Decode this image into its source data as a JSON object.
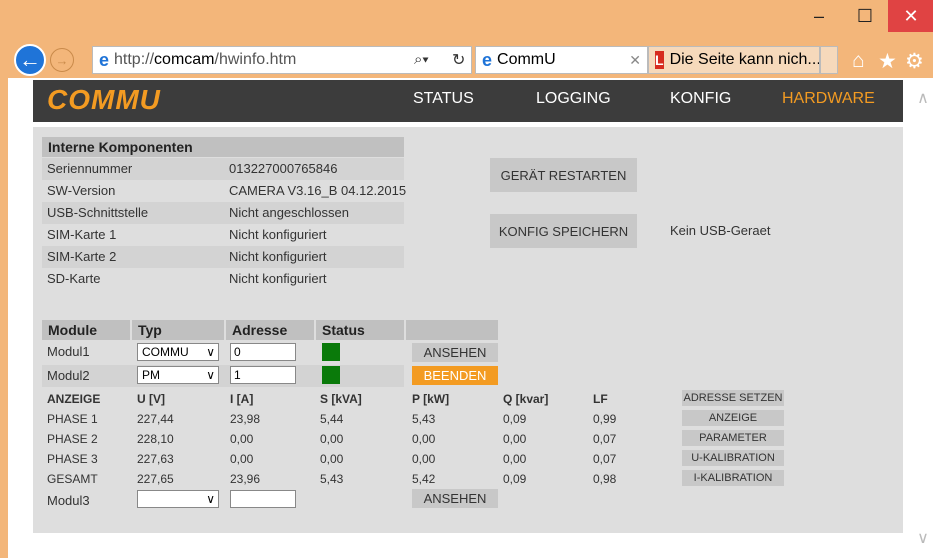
{
  "browser": {
    "url_prefix": "http://",
    "url_host": "comcam",
    "url_path": "/hwinfo.htm",
    "tab1_title": "CommU",
    "tab2_title": "Die Seite kann nich...",
    "tab2_badge": "L"
  },
  "nav": {
    "logo": "COMMU",
    "items": [
      "STATUS",
      "LOGGING",
      "KONFIG",
      "HARDWARE"
    ],
    "active": "HARDWARE",
    "accent": "#f39b22"
  },
  "interne": {
    "header": "Interne Komponenten",
    "rows": [
      {
        "label": "Seriennummer",
        "value": "013227000765846"
      },
      {
        "label": "SW-Version",
        "value": "CAMERA V3.16_B 04.12.2015"
      },
      {
        "label": "USB-Schnittstelle",
        "value": "Nicht angeschlossen"
      },
      {
        "label": "SIM-Karte 1",
        "value": "Nicht konfiguriert"
      },
      {
        "label": "SIM-Karte 2",
        "value": "Nicht konfiguriert"
      },
      {
        "label": "SD-Karte",
        "value": "Nicht konfiguriert"
      }
    ]
  },
  "actions": {
    "restart": "GERÄT RESTARTEN",
    "save_config": "KONFIG SPEICHERN",
    "usb_status": "Kein USB-Geraet"
  },
  "modules": {
    "headers": [
      "Module",
      "Typ",
      "Adresse",
      "Status"
    ],
    "rows": [
      {
        "name": "Modul1",
        "type": "COMMU",
        "address": "0",
        "status_color": "#0a7a0a",
        "action": "ANSEHEN"
      },
      {
        "name": "Modul2",
        "type": "PM",
        "address": "1",
        "status_color": "#0a7a0a",
        "action": "BEENDEN"
      },
      {
        "name": "Modul3",
        "type": "",
        "address": "",
        "action": "ANSEHEN"
      }
    ]
  },
  "measurements": {
    "headers": [
      "ANZEIGE",
      "U [V]",
      "I [A]",
      "S [kVA]",
      "P [kW]",
      "Q [kvar]",
      "LF"
    ],
    "rows": [
      [
        "PHASE 1",
        "227,44",
        "23,98",
        "5,44",
        "5,43",
        "0,09",
        "0,99"
      ],
      [
        "PHASE 2",
        "228,10",
        "0,00",
        "0,00",
        "0,00",
        "0,00",
        "0,07"
      ],
      [
        "PHASE 3",
        "227,63",
        "0,00",
        "0,00",
        "0,00",
        "0,00",
        "0,07"
      ],
      [
        "GESAMT",
        "227,65",
        "23,96",
        "5,43",
        "5,42",
        "0,09",
        "0,98"
      ]
    ],
    "side_buttons": [
      "ADRESSE SETZEN",
      "ANZEIGE",
      "PARAMETER",
      "U-KALIBRATION",
      "I-KALIBRATION"
    ]
  }
}
